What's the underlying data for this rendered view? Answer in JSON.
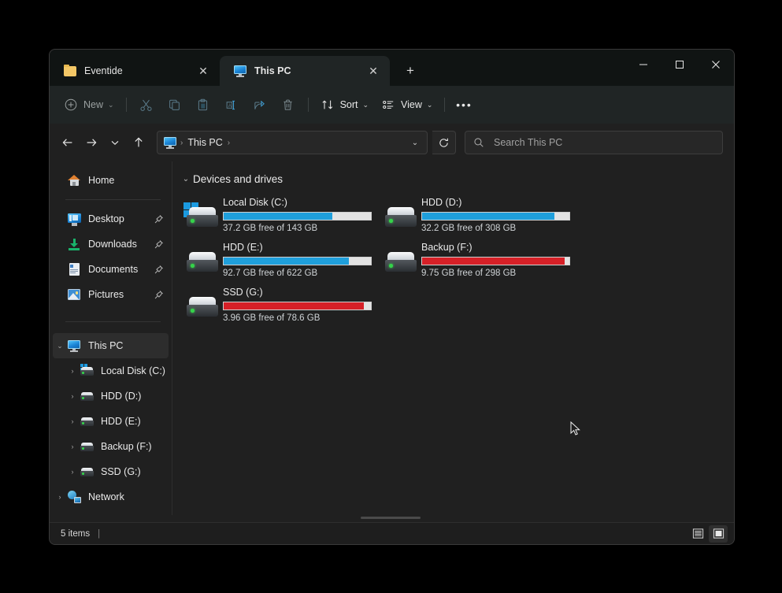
{
  "window": {
    "controls": {
      "minimize": "minimize",
      "maximize": "maximize",
      "close": "close"
    }
  },
  "tabs": [
    {
      "label": "Eventide",
      "icon": "folder-icon",
      "active": false,
      "close": "✕"
    },
    {
      "label": "This PC",
      "icon": "monitor-icon",
      "active": true,
      "close": "✕"
    }
  ],
  "new_tab_label": "+",
  "toolbar": {
    "new_label": "New",
    "new_chevron": "⌄",
    "cut_label": "Cut",
    "copy_label": "Copy",
    "paste_label": "Paste",
    "rename_label": "Rename",
    "share_label": "Share",
    "delete_label": "Delete",
    "sort_label": "Sort",
    "sort_chevron": "⌄",
    "view_label": "View",
    "view_chevron": "⌄",
    "more_label": "•••"
  },
  "address": {
    "back": "back",
    "forward": "forward",
    "recent_chevron": "⌄",
    "up": "up",
    "crumbs": [
      "This PC"
    ],
    "crumb_sep": "›",
    "dropdown_chevron": "⌄",
    "refresh": "refresh"
  },
  "search": {
    "placeholder": "Search This PC",
    "value": ""
  },
  "sidebar": {
    "home": {
      "label": "Home",
      "icon": "home-icon"
    },
    "quick_access": [
      {
        "label": "Desktop",
        "icon": "desktop-icon",
        "pinned": true
      },
      {
        "label": "Downloads",
        "icon": "downloads-icon",
        "pinned": true
      },
      {
        "label": "Documents",
        "icon": "documents-icon",
        "pinned": true
      },
      {
        "label": "Pictures",
        "icon": "pictures-icon",
        "pinned": true
      }
    ],
    "this_pc": {
      "label": "This PC",
      "icon": "monitor-icon",
      "expanded": true,
      "chevron": "⌄"
    },
    "drives": [
      {
        "label": "Local Disk (C:)",
        "icon": "windows-drive-icon",
        "chevron": "›"
      },
      {
        "label": "HDD (D:)",
        "icon": "drive-icon",
        "chevron": "›"
      },
      {
        "label": "HDD (E:)",
        "icon": "drive-icon",
        "chevron": "›"
      },
      {
        "label": "Backup (F:)",
        "icon": "drive-icon",
        "chevron": "›"
      },
      {
        "label": "SSD (G:)",
        "icon": "drive-icon",
        "chevron": "›"
      }
    ],
    "network": {
      "label": "Network",
      "icon": "network-icon",
      "chevron": "›"
    }
  },
  "content": {
    "group_title": "Devices and drives",
    "group_chevron": "⌄",
    "drives": [
      {
        "name": "Local Disk (C:)",
        "free_text": "37.2 GB free of 143 GB",
        "free_gb": 37.2,
        "total_gb": 143,
        "used_percent": 74,
        "bar_color": "#1f9fdb",
        "icon": "windows-drive-icon"
      },
      {
        "name": "HDD (D:)",
        "free_text": "32.2 GB free of 308 GB",
        "free_gb": 32.2,
        "total_gb": 308,
        "used_percent": 90,
        "bar_color": "#1f9fdb",
        "icon": "drive-icon"
      },
      {
        "name": "HDD (E:)",
        "free_text": "92.7 GB free of 622 GB",
        "free_gb": 92.7,
        "total_gb": 622,
        "used_percent": 85,
        "bar_color": "#1f9fdb",
        "icon": "drive-icon"
      },
      {
        "name": "Backup (F:)",
        "free_text": "9.75 GB free of 298 GB",
        "free_gb": 9.75,
        "total_gb": 298,
        "used_percent": 97,
        "bar_color": "#d62027",
        "icon": "drive-icon"
      },
      {
        "name": "SSD (G:)",
        "free_text": "3.96 GB free of 78.6 GB",
        "free_gb": 3.96,
        "total_gb": 78.6,
        "used_percent": 95,
        "bar_color": "#d62027",
        "icon": "drive-icon"
      }
    ]
  },
  "statusbar": {
    "items_text": "5 items",
    "separator": "|",
    "details_view": "details-view",
    "large_icons_view": "large-icons-view"
  }
}
